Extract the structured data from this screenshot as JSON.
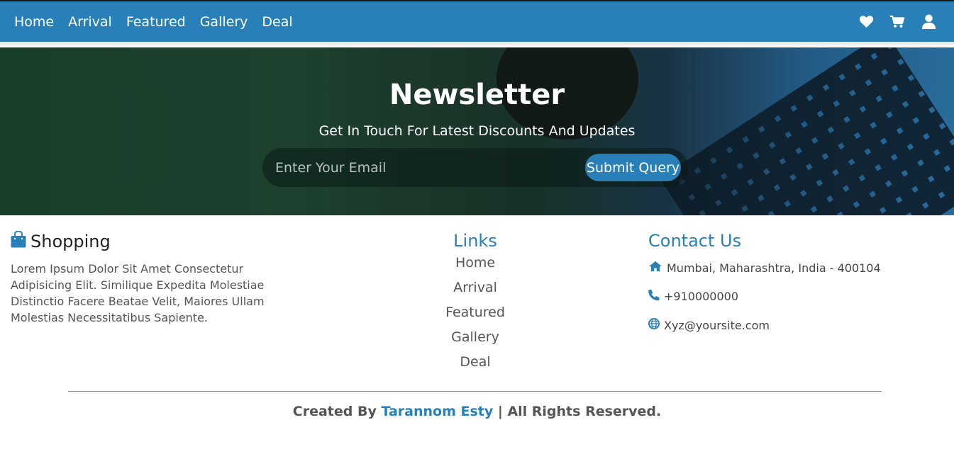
{
  "header": {
    "nav": [
      "Home",
      "Arrival",
      "Featured",
      "Gallery",
      "Deal"
    ],
    "icons": [
      "heart-icon",
      "cart-icon",
      "user-icon"
    ]
  },
  "newsletter": {
    "title": "Newsletter",
    "subtitle": "Get In Touch For Latest Discounts And Updates",
    "email_placeholder": "Enter Your Email",
    "submit_label": "Submit Query"
  },
  "footer": {
    "brand": {
      "title": "Shopping",
      "description": "Lorem Ipsum Dolor Sit Amet Consectetur Adipisicing Elit. Similique Expedita Molestiae Distinctio Facere Beatae Velit, Maiores Ullam Molestias Necessitatibus Sapiente."
    },
    "links": {
      "title": "Links",
      "items": [
        "Home",
        "Arrival",
        "Featured",
        "Gallery",
        "Deal"
      ]
    },
    "contact": {
      "title": "Contact Us",
      "address": "Mumbai, Maharashtra, India - 400104",
      "phone": "+910000000",
      "email": "Xyz@yoursite.com"
    },
    "credit": {
      "prefix": "Created By",
      "author": "Tarannom Esty",
      "suffix": "| All Rights Reserved."
    }
  },
  "colors": {
    "primary": "#2980b9",
    "text": "#555555"
  }
}
